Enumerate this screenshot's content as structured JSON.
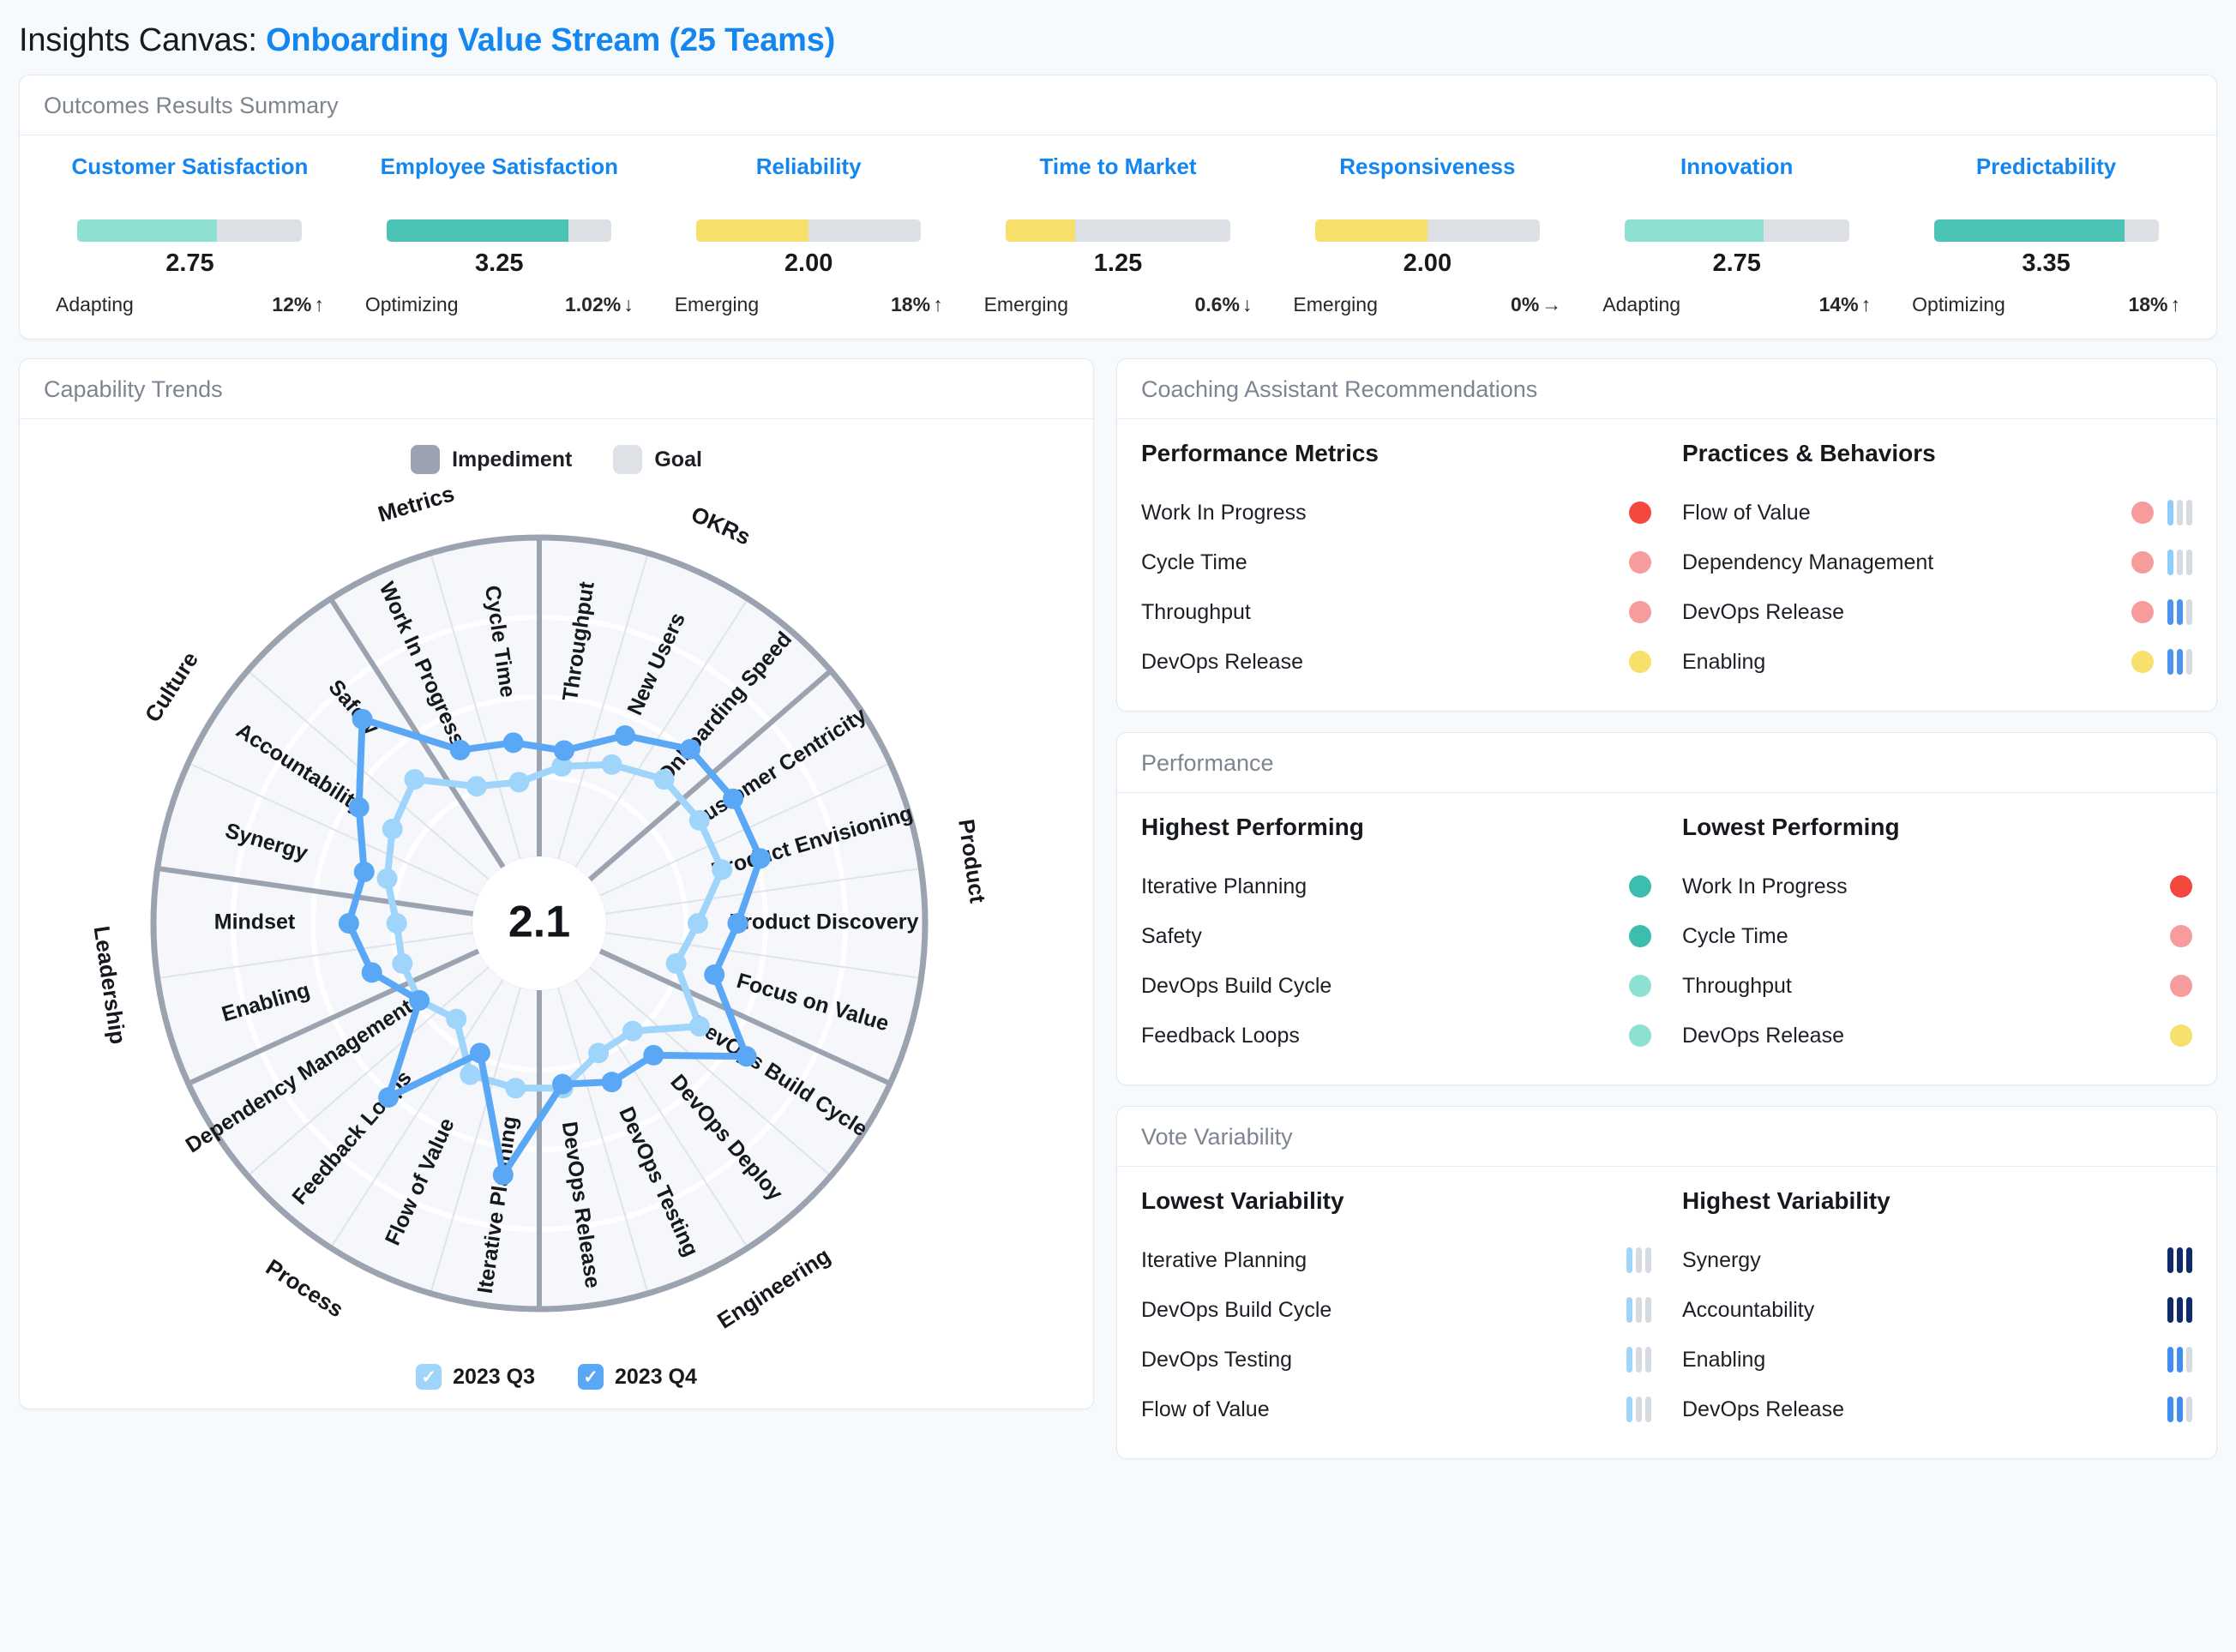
{
  "header": {
    "prefix": "Insights Canvas:",
    "title": "Onboarding Value Stream (25 Teams)",
    "accent_color": "#1486f0"
  },
  "outcomes_panel": {
    "heading": "Outcomes Results Summary",
    "items": [
      {
        "name": "Customer Satisfaction",
        "value": "2.75",
        "pct": 62,
        "bar_color": "#8ee0d3",
        "level": "Adapting",
        "delta": "12%",
        "trend": "up",
        "arrow": "↑"
      },
      {
        "name": "Employee Satisfaction",
        "value": "3.25",
        "pct": 81,
        "bar_color": "#4cc4b5",
        "level": "Optimizing",
        "delta": "1.02%",
        "trend": "down",
        "arrow": "↓"
      },
      {
        "name": "Reliability",
        "value": "2.00",
        "pct": 50,
        "bar_color": "#f6df6a",
        "level": "Emerging",
        "delta": "18%",
        "trend": "up",
        "arrow": "↑"
      },
      {
        "name": "Time to Market",
        "value": "1.25",
        "pct": 31,
        "bar_color": "#f6df6a",
        "level": "Emerging",
        "delta": "0.6%",
        "trend": "down",
        "arrow": "↓"
      },
      {
        "name": "Responsiveness",
        "value": "2.00",
        "pct": 50,
        "bar_color": "#f6df6a",
        "level": "Emerging",
        "delta": "0%",
        "trend": "flat",
        "arrow": "→"
      },
      {
        "name": "Innovation",
        "value": "2.75",
        "pct": 62,
        "bar_color": "#8ee0d3",
        "level": "Adapting",
        "delta": "14%",
        "trend": "up",
        "arrow": "↑"
      },
      {
        "name": "Predictability",
        "value": "3.35",
        "pct": 85,
        "bar_color": "#4cc4b5",
        "level": "Optimizing",
        "delta": "18%",
        "trend": "up",
        "arrow": "↑"
      }
    ]
  },
  "capability_panel": {
    "heading": "Capability Trends",
    "legend": [
      {
        "label": "Impediment",
        "color": "#9aa3af"
      },
      {
        "label": "Goal",
        "color": "#dfe3e8"
      }
    ],
    "center_value": "2.1",
    "series_toggles": [
      {
        "label": "2023 Q3",
        "checked": true,
        "color": "#9fd5fb",
        "check": "✓"
      },
      {
        "label": "2023 Q4",
        "checked": true,
        "color": "#5aa8f5",
        "check": "✓"
      }
    ]
  },
  "chart_data": {
    "type": "radar",
    "title": "Capability Trends",
    "center_label": "2.1",
    "rmin": 0,
    "rmax": 4,
    "rings": [
      1,
      2,
      3,
      4
    ],
    "groups": [
      {
        "name": "OKRs",
        "spokes": [
          "Throughput",
          "New Users",
          "Onboarding Speed"
        ]
      },
      {
        "name": "Product",
        "spokes": [
          "Customer Centricity",
          "Product Envisioning",
          "Product Discovery",
          "Focus on Value"
        ]
      },
      {
        "name": "Engineering",
        "spokes": [
          "DevOps Build Cycle",
          "DevOps Deploy",
          "DevOps Testing",
          "DevOps Release"
        ]
      },
      {
        "name": "Process",
        "spokes": [
          "Iterative Planning",
          "Flow of Value",
          "Feedback Loops",
          "Dependency Management"
        ]
      },
      {
        "name": "Leadership",
        "spokes": [
          "Enabling",
          "Mindset"
        ]
      },
      {
        "name": "Culture",
        "spokes": [
          "Synergy",
          "Accountability",
          "Safety"
        ]
      },
      {
        "name": "Metrics",
        "spokes": [
          "Work In Progress",
          "Cycle Time"
        ]
      }
    ],
    "axes": [
      "Customer Centricity",
      "Product Envisioning",
      "Product Discovery",
      "Focus on Value",
      "DevOps Build Cycle",
      "DevOps Deploy",
      "DevOps Testing",
      "DevOps Release",
      "Iterative Planning",
      "Flow of Value",
      "Feedback Loops",
      "Dependency Management",
      "Enabling",
      "Mindset",
      "Synergy",
      "Accountability",
      "Safety",
      "Work In Progress",
      "Cycle Time",
      "Throughput",
      "New Users",
      "Onboarding Speed"
    ],
    "series": [
      {
        "name": "2023 Q3",
        "color": "#9fd5fb",
        "values": [
          1.55,
          1.55,
          1.15,
          0.95,
          1.55,
          0.95,
          0.95,
          1.25,
          1.25,
          1.25,
          0.75,
          0.95,
          0.95,
          0.95,
          1.15,
          1.35,
          1.55,
          1.05,
          0.95,
          1.15,
          1.35,
          1.55
        ]
      },
      {
        "name": "2023 Q4",
        "color": "#5aa8f5",
        "values": [
          2.05,
          2.05,
          1.65,
          1.45,
          2.25,
          1.35,
          1.35,
          1.2,
          2.35,
          0.95,
          2.05,
          0.95,
          1.35,
          1.55,
          1.45,
          1.85,
          2.55,
          1.55,
          1.45,
          1.35,
          1.75,
          2.05
        ]
      }
    ]
  },
  "coaching_panel": {
    "heading": "Coaching Assistant Recommendations",
    "left_title": "Performance Metrics",
    "right_title": "Practices & Behaviors",
    "left_items": [
      {
        "label": "Work In Progress",
        "dot": "#f4473f"
      },
      {
        "label": "Cycle Time",
        "dot": "#f79c9c"
      },
      {
        "label": "Throughput",
        "dot": "#f79c9c"
      },
      {
        "label": "DevOps Release",
        "dot": "#f7e06b"
      }
    ],
    "right_items": [
      {
        "label": "Flow of Value",
        "dot": "#f79c9c",
        "bars": [
          "#8ecdfb",
          "#d6dbe1",
          "#d6dbe1"
        ]
      },
      {
        "label": "Dependency Management",
        "dot": "#f79c9c",
        "bars": [
          "#8ecdfb",
          "#d6dbe1",
          "#d6dbe1"
        ]
      },
      {
        "label": "DevOps Release",
        "dot": "#f79c9c",
        "bars": [
          "#4d94f0",
          "#4d94f0",
          "#d6dbe1"
        ]
      },
      {
        "label": "Enabling",
        "dot": "#f7e06b",
        "bars": [
          "#4d94f0",
          "#4d94f0",
          "#d6dbe1"
        ]
      }
    ]
  },
  "performance_panel": {
    "heading": "Performance",
    "left_title": "Highest Performing",
    "right_title": "Lowest Performing",
    "left_items": [
      {
        "label": "Iterative Planning",
        "dot": "#3dbdae"
      },
      {
        "label": "Safety",
        "dot": "#3dbdae"
      },
      {
        "label": "DevOps Build Cycle",
        "dot": "#8ee0d3"
      },
      {
        "label": "Feedback Loops",
        "dot": "#8ee0d3"
      }
    ],
    "right_items": [
      {
        "label": "Work In Progress",
        "dot": "#f4473f"
      },
      {
        "label": "Cycle Time",
        "dot": "#f79c9c"
      },
      {
        "label": "Throughput",
        "dot": "#f79c9c"
      },
      {
        "label": "DevOps Release",
        "dot": "#f7e06b"
      }
    ]
  },
  "variability_panel": {
    "heading": "Vote Variability",
    "left_title": "Lowest Variability",
    "right_title": "Highest Variability",
    "left_items": [
      {
        "label": "Iterative Planning",
        "bars": [
          "#9fd5fb",
          "#d6dbe1",
          "#d6dbe1"
        ]
      },
      {
        "label": "DevOps Build Cycle",
        "bars": [
          "#9fd5fb",
          "#d6dbe1",
          "#d6dbe1"
        ]
      },
      {
        "label": "DevOps Testing",
        "bars": [
          "#9fd5fb",
          "#d6dbe1",
          "#d6dbe1"
        ]
      },
      {
        "label": "Flow of Value",
        "bars": [
          "#9fd5fb",
          "#d6dbe1",
          "#d6dbe1"
        ]
      }
    ],
    "right_items": [
      {
        "label": "Synergy",
        "bars": [
          "#102a6b",
          "#102a6b",
          "#102a6b"
        ]
      },
      {
        "label": "Accountability",
        "bars": [
          "#102a6b",
          "#102a6b",
          "#102a6b"
        ]
      },
      {
        "label": "Enabling",
        "bars": [
          "#3f8ef0",
          "#3f8ef0",
          "#d6dbe1"
        ]
      },
      {
        "label": "DevOps Release",
        "bars": [
          "#3f8ef0",
          "#3f8ef0",
          "#d6dbe1"
        ]
      }
    ]
  }
}
